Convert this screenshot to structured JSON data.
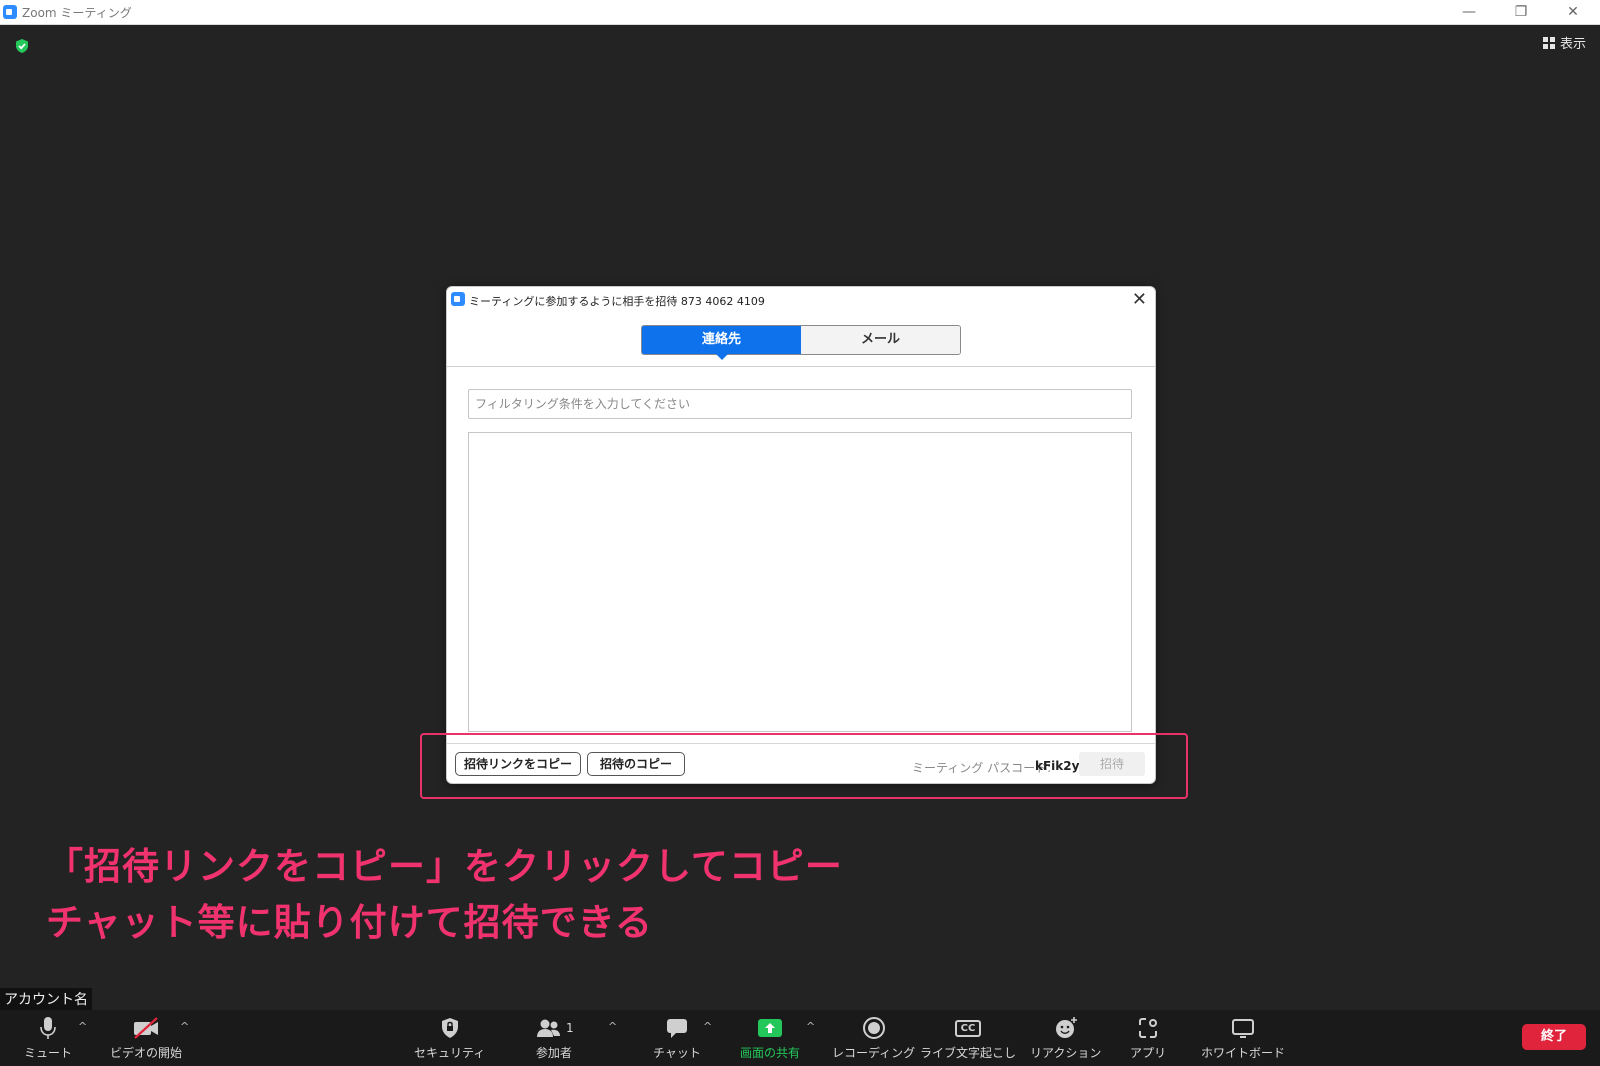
{
  "window": {
    "title": "Zoom ミーティング",
    "minimize": "—",
    "restore": "❐",
    "close": "✕"
  },
  "header": {
    "view_label": "表示",
    "security_badge_icon": "shield-check-icon"
  },
  "dialog": {
    "title": "ミーティングに参加するように相手を招待 873 4062 4109",
    "close": "✕",
    "tabs": [
      {
        "label": "連絡先",
        "active": true
      },
      {
        "label": "メール",
        "active": false
      }
    ],
    "filter_placeholder": "フィルタリング条件を入力してください",
    "copy_link_button": "招待リンクをコピー",
    "copy_invite_button": "招待のコピー",
    "passcode_label": "ミーティング パスコード:",
    "passcode_value": "kFik2y",
    "invite_button": "招待"
  },
  "annotation": {
    "line1": "「招待リンクをコピー」をクリックしてコピー",
    "line2": "チャット等に貼り付けて招待できる",
    "color": "#f0336e"
  },
  "account_name": "アカウント名",
  "toolbar": {
    "mute": "ミュート",
    "video": "ビデオの開始",
    "security": "セキュリティ",
    "participants": "参加者",
    "participants_count": "1",
    "chat": "チャット",
    "share": "画面の共有",
    "recording": "レコーディング",
    "captions": "ライブ文字起こし",
    "captions_icon_text": "CC",
    "reactions": "リアクション",
    "apps": "アプリ",
    "whiteboard": "ホワイトボード",
    "end": "終了",
    "caret": "^"
  },
  "colors": {
    "accent": "#0e72ed",
    "share_green": "#24c75a",
    "end_red": "#e0243c",
    "highlight": "#e8336a",
    "background": "#232323"
  }
}
